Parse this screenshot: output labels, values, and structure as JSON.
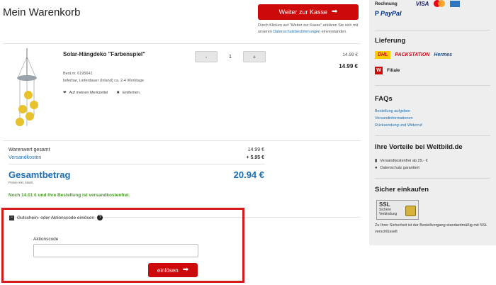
{
  "cart": {
    "title": "Mein Warenkorb",
    "checkout_button": "Weiter zur Kasse",
    "checkout_note_pre": "Durch Klicken auf \"Weiter zur Kasse\" erklären Sie sich mit unseren ",
    "checkout_note_link": "Datenschutzbestimmungen",
    "checkout_note_post": " einverstanden."
  },
  "product": {
    "name": "Solar-Hängdeko \"Farbenspiel\"",
    "order_number": "Best.nr. 6195641",
    "delivery": "lieferbar, Lieferdauer (Inland) ca. 2-4 Werktage",
    "wishlist_label": "Auf meinen Merkzettel",
    "remove_label": "Entfernen",
    "quantity": "1",
    "minus": "-",
    "plus": "+",
    "unit_price": "14.99 €",
    "total_price": "14.99 €"
  },
  "totals": {
    "goods_label": "Warenwert gesamt",
    "goods_value": "14.99 €",
    "shipping_label": "Versandkosten",
    "shipping_value": "+ 5.95 €",
    "grand_label": "Gesamtbetrag",
    "grand_value": "20.94 €",
    "vat_note": "Preise inkl. MwSt.",
    "free_shipping_note": "Noch 14.01 € und Ihre Bestellung ist versandkostenfrei."
  },
  "coupon": {
    "toggle_label": "Gutschein- oder Aktionscode einlösen",
    "toggle_symbol": "−",
    "help_symbol": "?",
    "field_label": "Aktionscode",
    "field_value": "",
    "redeem_button": "einlösen"
  },
  "sidebar": {
    "payment": {
      "invoice_label": "Rechnung",
      "visa_label": "VISA",
      "paypal_label": "PayPal"
    },
    "delivery": {
      "title": "Lieferung",
      "dhl": "DHL",
      "packstation": "PACKSTATION",
      "hermes": "Hermes",
      "filiale": "Filiale"
    },
    "faqs": {
      "title": "FAQs",
      "links": [
        "Bestellung aufgeben",
        "Versandinformationen",
        "Rücksendung und Widerruf"
      ]
    },
    "benefits": {
      "title": "Ihre Vorteile bei Weltbild.de",
      "items": [
        "Versandkostenfrei ab 29.- €",
        "Datenschutz garantiert"
      ]
    },
    "secure": {
      "title": "Sicher einkaufen",
      "badge_title": "SSL",
      "badge_sub1": "Sichere",
      "badge_sub2": "Verbindung",
      "text": "Zu Ihrer Sicherheit ist der Bestellvorgang standardmäßig mit SSL verschlüsselt"
    }
  },
  "colors": {
    "accent_red": "#cc0a0a",
    "link_blue": "#1a6fb5",
    "success_green": "#4a9a2a",
    "highlight_border": "#d41e1e"
  }
}
